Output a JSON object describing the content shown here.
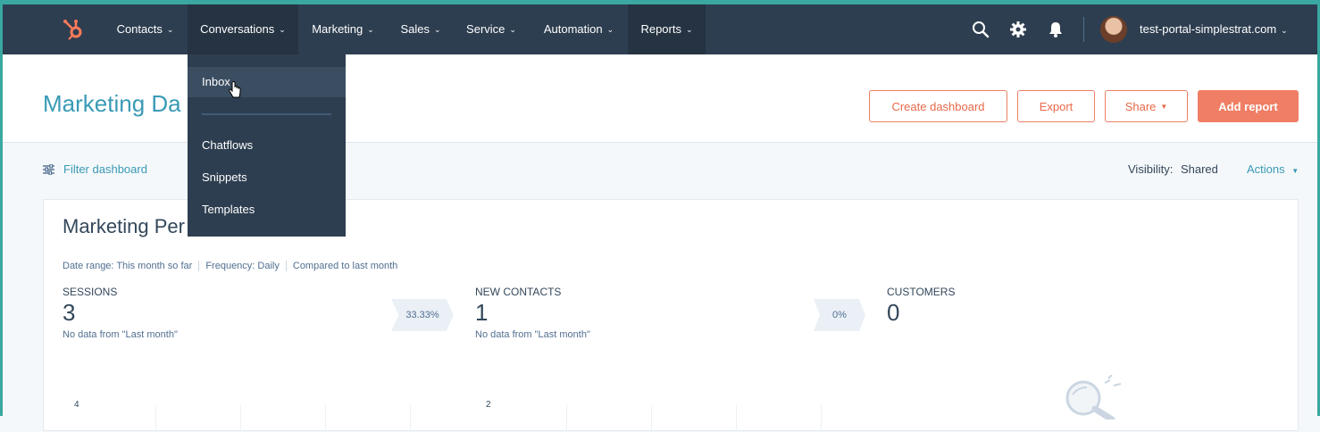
{
  "nav": {
    "items": [
      {
        "label": "Contacts"
      },
      {
        "label": "Conversations"
      },
      {
        "label": "Marketing"
      },
      {
        "label": "Sales"
      },
      {
        "label": "Service"
      },
      {
        "label": "Automation"
      },
      {
        "label": "Reports"
      }
    ],
    "portal_name": "test-portal-simplestrat.com",
    "icons": [
      "search-icon",
      "gear-icon",
      "bell-icon"
    ]
  },
  "dropdown": {
    "items": [
      {
        "label": "Inbox"
      },
      {
        "label": "Chatflows"
      },
      {
        "label": "Snippets"
      },
      {
        "label": "Templates"
      }
    ]
  },
  "header": {
    "title": "Marketing Da",
    "buttons": {
      "create": "Create dashboard",
      "export": "Export",
      "share": "Share",
      "add_report": "Add report"
    }
  },
  "filter_row": {
    "filter_label": "Filter dashboard",
    "visibility_label": "Visibility:",
    "visibility_value": "Shared",
    "actions_label": "Actions"
  },
  "card": {
    "title": "Marketing Per",
    "meta": {
      "date_range": "Date range: This month so far",
      "frequency": "Frequency: Daily",
      "compared": "Compared to last month"
    },
    "kpis": [
      {
        "label": "SESSIONS",
        "value": "3",
        "note": "No data from \"Last month\""
      },
      {
        "label": "NEW CONTACTS",
        "value": "1",
        "note": "No data from \"Last month\""
      },
      {
        "label": "CUSTOMERS",
        "value": "0",
        "note": ""
      }
    ],
    "badges": [
      "33.33%",
      "0%"
    ],
    "axis_ticks": [
      "4",
      "2"
    ]
  },
  "colors": {
    "nav_bg": "#2d3e50",
    "accent_orange": "#f07e64",
    "link_teal": "#3a9ab5"
  }
}
